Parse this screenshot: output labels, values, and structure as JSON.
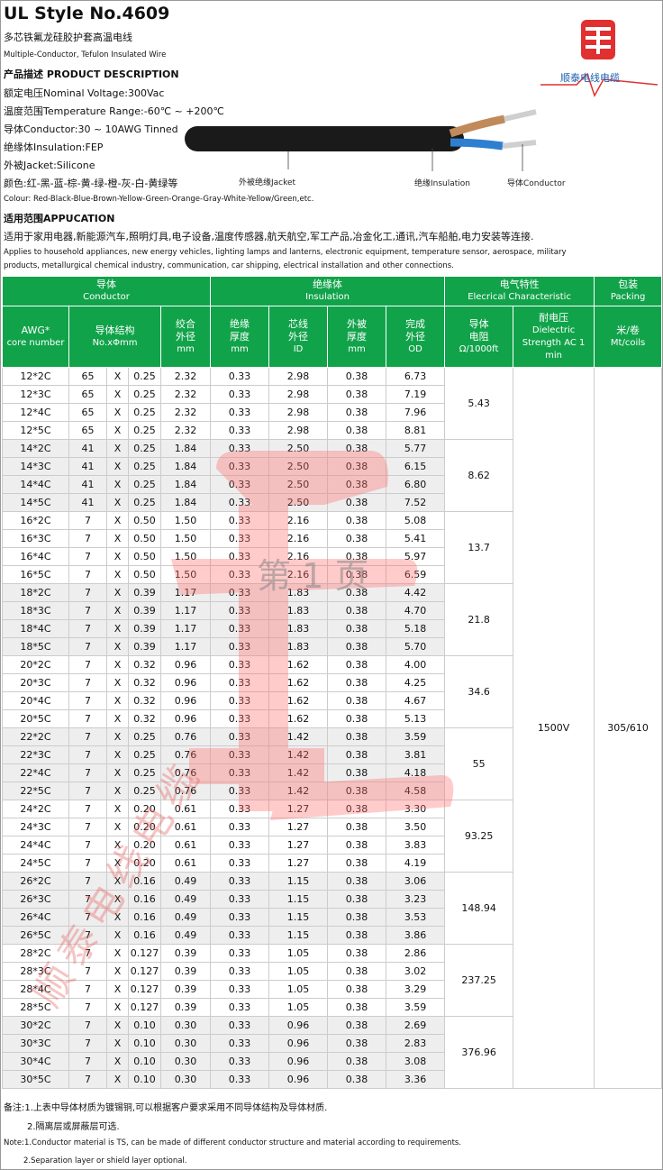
{
  "header": {
    "title": "UL Style No.4609",
    "subtitle_cn": "多芯铁氟龙硅胶护套高温电线",
    "subtitle_en": "Multiple-Conductor, Tefulon Insulated Wire",
    "product_desc_heading": "产品描述 PRODUCT DESCRIPTION",
    "rated_voltage": "额定电压Nominal Voltage:300Vac",
    "temp_range": "温度范围Temperature Range:-60℃ ~ +200℃",
    "conductor": "导体Conductor:30 ~ 10AWG Tinned",
    "insulation": "绝缘体Insulation:FEP",
    "jacket": "外被Jacket:Silicone",
    "colour_cn": "颜色:红-黑-蓝-棕-黄-绿-橙-灰-白-黄绿等",
    "colour_en": "Colour: Red-Black-Blue-Brown-Yellow-Green-Orange-Gray-White-Yellow/Green,etc.",
    "application_heading": "适用范围APPUCATION",
    "application_cn": "适用于家用电器,新能源汽车,照明灯具,电子设备,温度传感器,航天航空,军工产品,冶金化工,通讯,汽车船舶,电力安装等连接.",
    "application_en_1": "Applies to household appliances, new energy vehicles, lighting lamps and lanterns, electronic equipment, temperature sensor, aerospace, military",
    "application_en_2": "products, metallurgical chemical industry, communication, car shipping, electrical installation and other connections.",
    "logo_text": "顺泰电线电缆",
    "logo_colors": {
      "red": "#e03030",
      "blue": "#1b5fb0"
    }
  },
  "diagram": {
    "label_jacket": "外被绝缘Jacket",
    "label_insulation": "绝缘Insulation",
    "label_conductor": "导体Conductor"
  },
  "table": {
    "group_headers": [
      {
        "cn": "导体",
        "en": "Conductor"
      },
      {
        "cn": "绝缘体",
        "en": "Insulation"
      },
      {
        "cn": "电气特性",
        "en": "Elecrical Characteristic"
      },
      {
        "cn": "包装",
        "en": "Packing"
      }
    ],
    "col_headers": {
      "awg": [
        "AWG*",
        "core number"
      ],
      "structure": [
        "导体结构",
        "No.xΦmm"
      ],
      "twist_od": [
        "绞合",
        "外径",
        "mm"
      ],
      "ins_thickness": [
        "绝缘",
        "厚度",
        "mm"
      ],
      "core_od": [
        "芯线",
        "外径",
        "ID"
      ],
      "jacket_thickness": [
        "外被",
        "厚度",
        "mm"
      ],
      "finished_od": [
        "完成",
        "外径",
        "OD"
      ],
      "resistance": [
        "导体",
        "电阻",
        "Ω/1000ft"
      ],
      "dielectric": [
        "耐电压",
        "Dielectric",
        "Strength AC 1",
        "min"
      ],
      "packing": [
        "米/卷",
        "Mt/coils"
      ]
    },
    "times_sign": "X",
    "dielectric_value": "1500V",
    "packing_value": "305/610",
    "groups": [
      {
        "resistance": "5.43",
        "rows": [
          [
            "12*2C",
            "65",
            "0.25",
            "2.32",
            "0.33",
            "2.98",
            "0.38",
            "6.73"
          ],
          [
            "12*3C",
            "65",
            "0.25",
            "2.32",
            "0.33",
            "2.98",
            "0.38",
            "7.19"
          ],
          [
            "12*4C",
            "65",
            "0.25",
            "2.32",
            "0.33",
            "2.98",
            "0.38",
            "7.96"
          ],
          [
            "12*5C",
            "65",
            "0.25",
            "2.32",
            "0.33",
            "2.98",
            "0.38",
            "8.81"
          ]
        ]
      },
      {
        "resistance": "8.62",
        "rows": [
          [
            "14*2C",
            "41",
            "0.25",
            "1.84",
            "0.33",
            "2.50",
            "0.38",
            "5.77"
          ],
          [
            "14*3C",
            "41",
            "0.25",
            "1.84",
            "0.33",
            "2.50",
            "0.38",
            "6.15"
          ],
          [
            "14*4C",
            "41",
            "0.25",
            "1.84",
            "0.33",
            "2.50",
            "0.38",
            "6.80"
          ],
          [
            "14*5C",
            "41",
            "0.25",
            "1.84",
            "0.33",
            "2.50",
            "0.38",
            "7.52"
          ]
        ]
      },
      {
        "resistance": "13.7",
        "rows": [
          [
            "16*2C",
            "7",
            "0.50",
            "1.50",
            "0.33",
            "2.16",
            "0.38",
            "5.08"
          ],
          [
            "16*3C",
            "7",
            "0.50",
            "1.50",
            "0.33",
            "2.16",
            "0.38",
            "5.41"
          ],
          [
            "16*4C",
            "7",
            "0.50",
            "1.50",
            "0.33",
            "2.16",
            "0.38",
            "5.97"
          ],
          [
            "16*5C",
            "7",
            "0.50",
            "1.50",
            "0.33",
            "2.16",
            "0.38",
            "6.59"
          ]
        ]
      },
      {
        "resistance": "21.8",
        "rows": [
          [
            "18*2C",
            "7",
            "0.39",
            "1.17",
            "0.33",
            "1.83",
            "0.38",
            "4.42"
          ],
          [
            "18*3C",
            "7",
            "0.39",
            "1.17",
            "0.33",
            "1.83",
            "0.38",
            "4.70"
          ],
          [
            "18*4C",
            "7",
            "0.39",
            "1.17",
            "0.33",
            "1.83",
            "0.38",
            "5.18"
          ],
          [
            "18*5C",
            "7",
            "0.39",
            "1.17",
            "0.33",
            "1.83",
            "0.38",
            "5.70"
          ]
        ]
      },
      {
        "resistance": "34.6",
        "rows": [
          [
            "20*2C",
            "7",
            "0.32",
            "0.96",
            "0.33",
            "1.62",
            "0.38",
            "4.00"
          ],
          [
            "20*3C",
            "7",
            "0.32",
            "0.96",
            "0.33",
            "1.62",
            "0.38",
            "4.25"
          ],
          [
            "20*4C",
            "7",
            "0.32",
            "0.96",
            "0.33",
            "1.62",
            "0.38",
            "4.67"
          ],
          [
            "20*5C",
            "7",
            "0.32",
            "0.96",
            "0.33",
            "1.62",
            "0.38",
            "5.13"
          ]
        ]
      },
      {
        "resistance": "55",
        "rows": [
          [
            "22*2C",
            "7",
            "0.25",
            "0.76",
            "0.33",
            "1.42",
            "0.38",
            "3.59"
          ],
          [
            "22*3C",
            "7",
            "0.25",
            "0.76",
            "0.33",
            "1.42",
            "0.38",
            "3.81"
          ],
          [
            "22*4C",
            "7",
            "0.25",
            "0.76",
            "0.33",
            "1.42",
            "0.38",
            "4.18"
          ],
          [
            "22*5C",
            "7",
            "0.25",
            "0.76",
            "0.33",
            "1.42",
            "0.38",
            "4.58"
          ]
        ]
      },
      {
        "resistance": "93.25",
        "rows": [
          [
            "24*2C",
            "7",
            "0.20",
            "0.61",
            "0.33",
            "1.27",
            "0.38",
            "3.30"
          ],
          [
            "24*3C",
            "7",
            "0.20",
            "0.61",
            "0.33",
            "1.27",
            "0.38",
            "3.50"
          ],
          [
            "24*4C",
            "7",
            "0.20",
            "0.61",
            "0.33",
            "1.27",
            "0.38",
            "3.83"
          ],
          [
            "24*5C",
            "7",
            "0.20",
            "0.61",
            "0.33",
            "1.27",
            "0.38",
            "4.19"
          ]
        ]
      },
      {
        "resistance": "148.94",
        "rows": [
          [
            "26*2C",
            "7",
            "0.16",
            "0.49",
            "0.33",
            "1.15",
            "0.38",
            "3.06"
          ],
          [
            "26*3C",
            "7",
            "0.16",
            "0.49",
            "0.33",
            "1.15",
            "0.38",
            "3.23"
          ],
          [
            "26*4C",
            "7",
            "0.16",
            "0.49",
            "0.33",
            "1.15",
            "0.38",
            "3.53"
          ],
          [
            "26*5C",
            "7",
            "0.16",
            "0.49",
            "0.33",
            "1.15",
            "0.38",
            "3.86"
          ]
        ]
      },
      {
        "resistance": "237.25",
        "rows": [
          [
            "28*2C",
            "7",
            "0.127",
            "0.39",
            "0.33",
            "1.05",
            "0.38",
            "2.86"
          ],
          [
            "28*3C",
            "7",
            "0.127",
            "0.39",
            "0.33",
            "1.05",
            "0.38",
            "3.02"
          ],
          [
            "28*4C",
            "7",
            "0.127",
            "0.39",
            "0.33",
            "1.05",
            "0.38",
            "3.29"
          ],
          [
            "28*5C",
            "7",
            "0.127",
            "0.39",
            "0.33",
            "1.05",
            "0.38",
            "3.59"
          ]
        ]
      },
      {
        "resistance": "376.96",
        "rows": [
          [
            "30*2C",
            "7",
            "0.10",
            "0.30",
            "0.33",
            "0.96",
            "0.38",
            "2.69"
          ],
          [
            "30*3C",
            "7",
            "0.10",
            "0.30",
            "0.33",
            "0.96",
            "0.38",
            "2.83"
          ],
          [
            "30*4C",
            "7",
            "0.10",
            "0.30",
            "0.33",
            "0.96",
            "0.38",
            "3.08"
          ],
          [
            "30*5C",
            "7",
            "0.10",
            "0.30",
            "0.33",
            "0.96",
            "0.38",
            "3.36"
          ]
        ]
      }
    ]
  },
  "notes": {
    "cn_1": "备注:1.上表中导体材质为镀锡铜,可以根据客户要求采用不同导体结构及导体材质.",
    "cn_2": "2.隔离层或屏蔽层可选.",
    "en_1": "Note:1.Conductor material is TS, can be made of different conductor structure and material according to requirements.",
    "en_2": "2.Separation layer or shield layer optional."
  },
  "watermark": {
    "page_text": "第 1 页",
    "brand_text": "顺泰电线电缆"
  }
}
